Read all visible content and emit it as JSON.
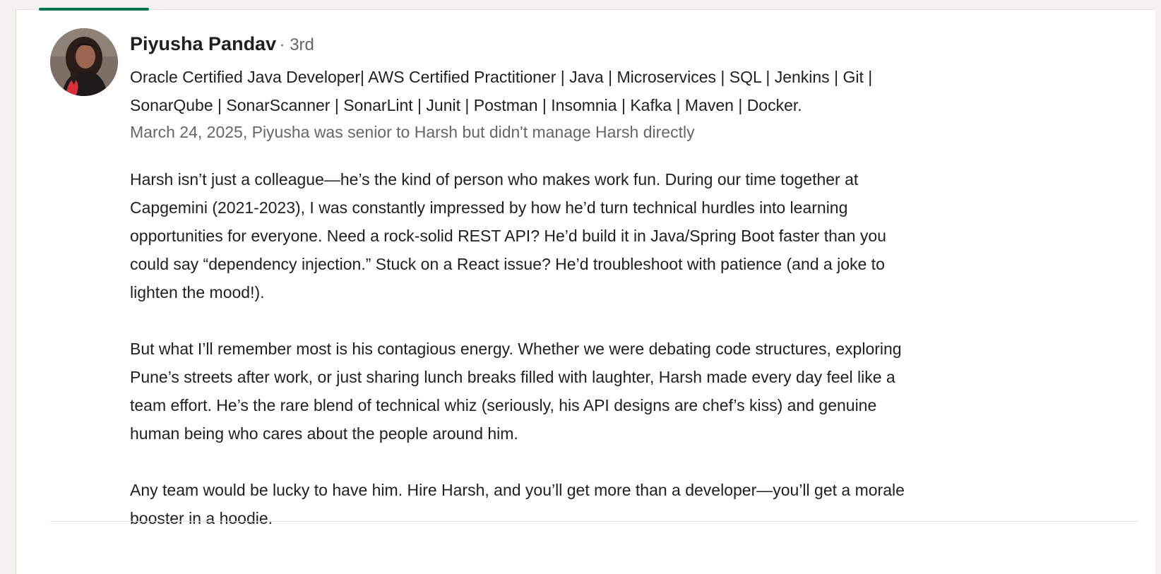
{
  "recommender": {
    "name": "Piyusha Pandav",
    "degree": "· 3rd",
    "headline_lines": [
      "Oracle Certified Java Developer| AWS Certified Practitioner | Java | Microservices | SQL | Jenkins | Git |",
      "SonarQube | SonarScanner | SonarLint | Junit | Postman | Insomnia | Kafka | Maven | Docker."
    ],
    "relationship": "March 24, 2025, Piyusha was senior to Harsh but didn't manage Harsh directly"
  },
  "recommendation": {
    "paragraph1": [
      "Harsh isn’t just a colleague—he’s the kind of person who makes work fun. During our time together at",
      "Capgemini (2021-2023), I was constantly impressed by how he’d turn technical hurdles into learning",
      "opportunities for everyone. Need a rock-solid REST API? He’d build it in Java/Spring Boot faster than you",
      "could say “dependency injection.” Stuck on a React issue? He’d troubleshoot with patience (and a joke to",
      "lighten the mood!)."
    ],
    "paragraph2": [
      "But what I’ll remember most is his contagious energy. Whether we were debating code structures, exploring",
      "Pune’s streets after work, or just sharing lunch breaks filled with laughter, Harsh made every day feel like a",
      "team effort. He’s the rare blend of technical whiz (seriously, his API designs are chef’s kiss) and genuine",
      "human being who cares about the people around him."
    ],
    "paragraph3": [
      "Any team would be lucky to have him. Hire Harsh, and you’ll get more than a developer—you’ll get a morale",
      "booster in a hoodie."
    ]
  },
  "colors": {
    "accent_tab": "#01754f",
    "text_primary": "#1f1f1f",
    "text_secondary": "#666666",
    "page_background": "#f4f2ee"
  }
}
